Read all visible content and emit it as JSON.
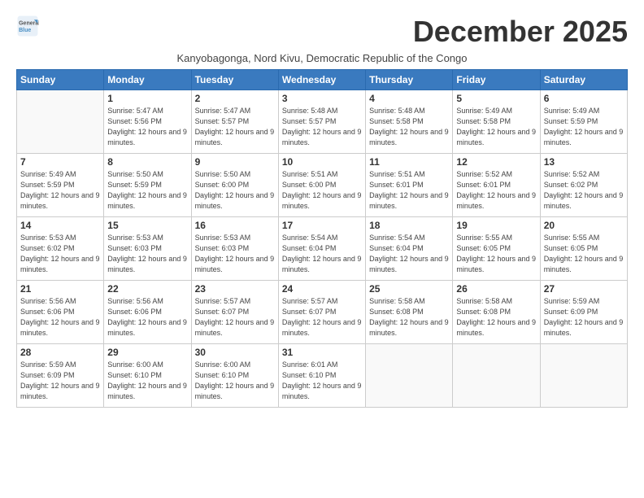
{
  "header": {
    "logo_line1": "General",
    "logo_line2": "Blue",
    "month_title": "December 2025",
    "subtitle": "Kanyobagonga, Nord Kivu, Democratic Republic of the Congo"
  },
  "days_of_week": [
    "Sunday",
    "Monday",
    "Tuesday",
    "Wednesday",
    "Thursday",
    "Friday",
    "Saturday"
  ],
  "weeks": [
    [
      {
        "day": null
      },
      {
        "day": 1,
        "sunrise": "5:47 AM",
        "sunset": "5:56 PM",
        "daylight": "12 hours and 9 minutes."
      },
      {
        "day": 2,
        "sunrise": "5:47 AM",
        "sunset": "5:57 PM",
        "daylight": "12 hours and 9 minutes."
      },
      {
        "day": 3,
        "sunrise": "5:48 AM",
        "sunset": "5:57 PM",
        "daylight": "12 hours and 9 minutes."
      },
      {
        "day": 4,
        "sunrise": "5:48 AM",
        "sunset": "5:58 PM",
        "daylight": "12 hours and 9 minutes."
      },
      {
        "day": 5,
        "sunrise": "5:49 AM",
        "sunset": "5:58 PM",
        "daylight": "12 hours and 9 minutes."
      },
      {
        "day": 6,
        "sunrise": "5:49 AM",
        "sunset": "5:59 PM",
        "daylight": "12 hours and 9 minutes."
      }
    ],
    [
      {
        "day": 7,
        "sunrise": "5:49 AM",
        "sunset": "5:59 PM",
        "daylight": "12 hours and 9 minutes."
      },
      {
        "day": 8,
        "sunrise": "5:50 AM",
        "sunset": "5:59 PM",
        "daylight": "12 hours and 9 minutes."
      },
      {
        "day": 9,
        "sunrise": "5:50 AM",
        "sunset": "6:00 PM",
        "daylight": "12 hours and 9 minutes."
      },
      {
        "day": 10,
        "sunrise": "5:51 AM",
        "sunset": "6:00 PM",
        "daylight": "12 hours and 9 minutes."
      },
      {
        "day": 11,
        "sunrise": "5:51 AM",
        "sunset": "6:01 PM",
        "daylight": "12 hours and 9 minutes."
      },
      {
        "day": 12,
        "sunrise": "5:52 AM",
        "sunset": "6:01 PM",
        "daylight": "12 hours and 9 minutes."
      },
      {
        "day": 13,
        "sunrise": "5:52 AM",
        "sunset": "6:02 PM",
        "daylight": "12 hours and 9 minutes."
      }
    ],
    [
      {
        "day": 14,
        "sunrise": "5:53 AM",
        "sunset": "6:02 PM",
        "daylight": "12 hours and 9 minutes."
      },
      {
        "day": 15,
        "sunrise": "5:53 AM",
        "sunset": "6:03 PM",
        "daylight": "12 hours and 9 minutes."
      },
      {
        "day": 16,
        "sunrise": "5:53 AM",
        "sunset": "6:03 PM",
        "daylight": "12 hours and 9 minutes."
      },
      {
        "day": 17,
        "sunrise": "5:54 AM",
        "sunset": "6:04 PM",
        "daylight": "12 hours and 9 minutes."
      },
      {
        "day": 18,
        "sunrise": "5:54 AM",
        "sunset": "6:04 PM",
        "daylight": "12 hours and 9 minutes."
      },
      {
        "day": 19,
        "sunrise": "5:55 AM",
        "sunset": "6:05 PM",
        "daylight": "12 hours and 9 minutes."
      },
      {
        "day": 20,
        "sunrise": "5:55 AM",
        "sunset": "6:05 PM",
        "daylight": "12 hours and 9 minutes."
      }
    ],
    [
      {
        "day": 21,
        "sunrise": "5:56 AM",
        "sunset": "6:06 PM",
        "daylight": "12 hours and 9 minutes."
      },
      {
        "day": 22,
        "sunrise": "5:56 AM",
        "sunset": "6:06 PM",
        "daylight": "12 hours and 9 minutes."
      },
      {
        "day": 23,
        "sunrise": "5:57 AM",
        "sunset": "6:07 PM",
        "daylight": "12 hours and 9 minutes."
      },
      {
        "day": 24,
        "sunrise": "5:57 AM",
        "sunset": "6:07 PM",
        "daylight": "12 hours and 9 minutes."
      },
      {
        "day": 25,
        "sunrise": "5:58 AM",
        "sunset": "6:08 PM",
        "daylight": "12 hours and 9 minutes."
      },
      {
        "day": 26,
        "sunrise": "5:58 AM",
        "sunset": "6:08 PM",
        "daylight": "12 hours and 9 minutes."
      },
      {
        "day": 27,
        "sunrise": "5:59 AM",
        "sunset": "6:09 PM",
        "daylight": "12 hours and 9 minutes."
      }
    ],
    [
      {
        "day": 28,
        "sunrise": "5:59 AM",
        "sunset": "6:09 PM",
        "daylight": "12 hours and 9 minutes."
      },
      {
        "day": 29,
        "sunrise": "6:00 AM",
        "sunset": "6:10 PM",
        "daylight": "12 hours and 9 minutes."
      },
      {
        "day": 30,
        "sunrise": "6:00 AM",
        "sunset": "6:10 PM",
        "daylight": "12 hours and 9 minutes."
      },
      {
        "day": 31,
        "sunrise": "6:01 AM",
        "sunset": "6:10 PM",
        "daylight": "12 hours and 9 minutes."
      },
      {
        "day": null
      },
      {
        "day": null
      },
      {
        "day": null
      }
    ]
  ]
}
